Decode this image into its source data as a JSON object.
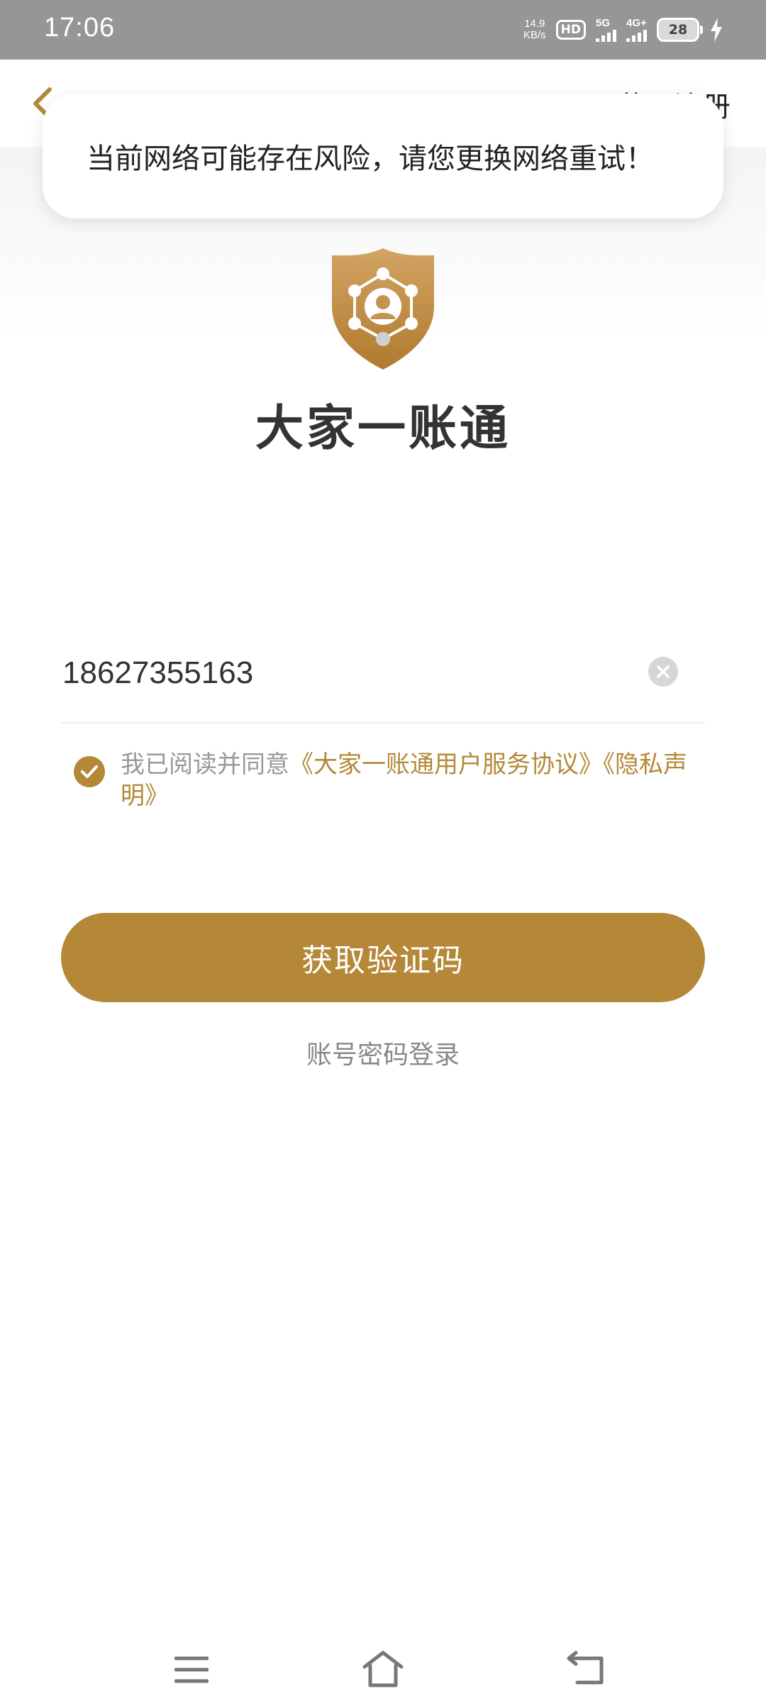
{
  "status_bar": {
    "time": "17:06",
    "net_speed_value": "14.9",
    "net_speed_unit": "KB/s",
    "hd_badge": "HD",
    "sim1_label": "5G",
    "sim2_label": "4G+",
    "battery": "28"
  },
  "nav": {
    "right_label": "获取注册"
  },
  "toast": {
    "message": "当前网络可能存在风险，请您更换网络重试！"
  },
  "app": {
    "title": "大家一账通"
  },
  "form": {
    "phone_value": "18627355163",
    "agreement_prefix": "我已阅读并同意",
    "agreement_link1": "《大家一账通用户服务协议》",
    "agreement_link2": "《隐私声明》",
    "primary_button": "获取验证码",
    "secondary_link": "账号密码登录"
  },
  "colors": {
    "accent": "#b58838",
    "status_bar": "#969696"
  },
  "icons": [
    "back-arrow-icon",
    "shield-logo-icon",
    "clear-icon",
    "check-icon",
    "menu-icon",
    "home-icon",
    "back-icon"
  ]
}
